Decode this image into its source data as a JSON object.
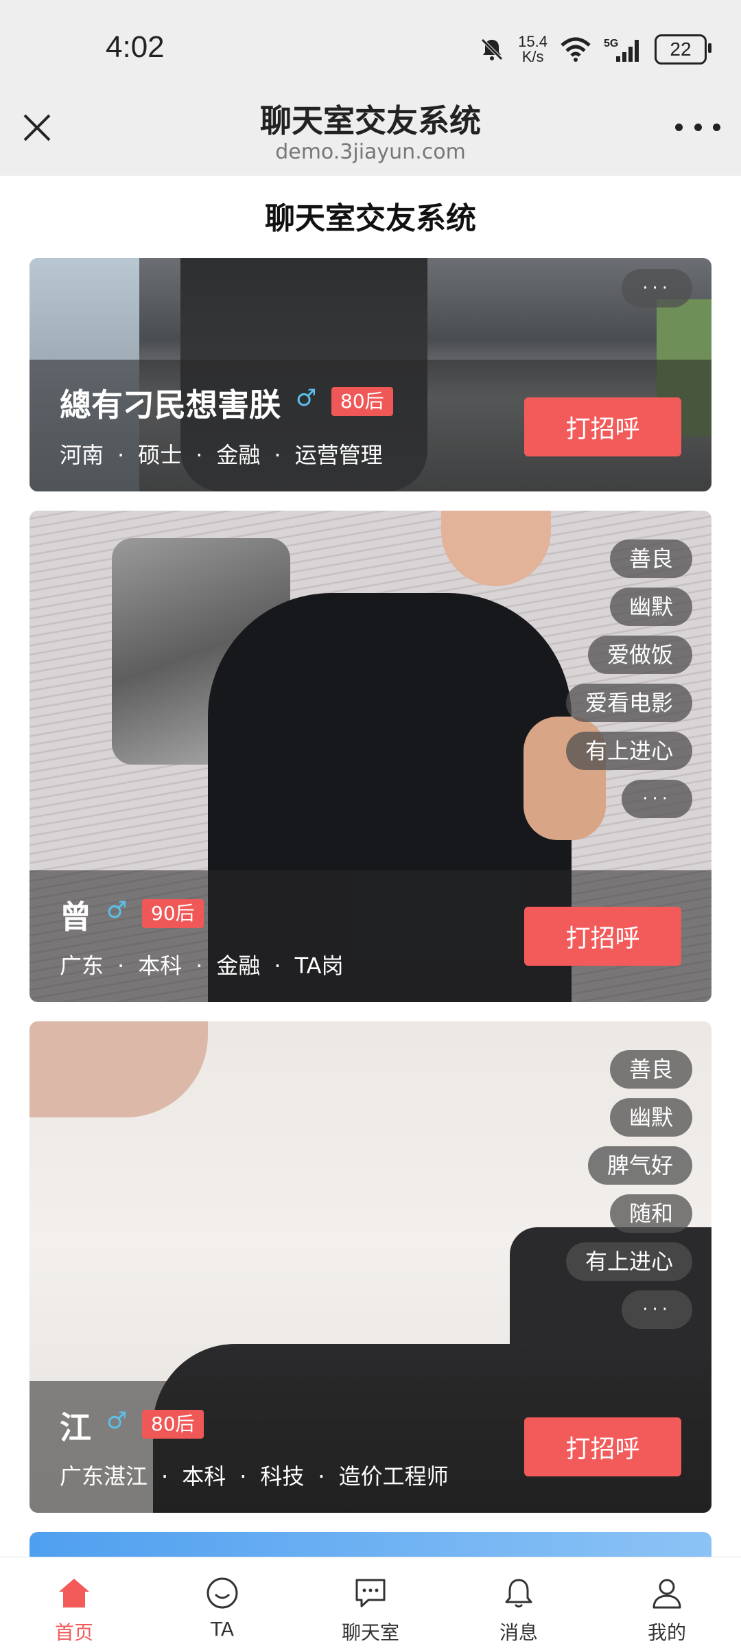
{
  "status_bar": {
    "time": "4:02",
    "net_speed_value": "15.4",
    "net_speed_unit": "K/s",
    "signal": "5G",
    "battery": "22"
  },
  "browser": {
    "title": "聊天室交友系统",
    "url": "demo.3jiayun.com"
  },
  "app": {
    "title": "聊天室交友系统"
  },
  "colors": {
    "accent": "#f35a5a",
    "age_badge": "#f05858",
    "male": "#5bc0eb"
  },
  "cards": [
    {
      "name": "總有刁民想害朕",
      "gender": "♂",
      "age": "80后",
      "location": "河南",
      "education": "硕士",
      "industry": "金融",
      "job": "运营管理",
      "tags": [],
      "more": "···",
      "greet": "打招呼"
    },
    {
      "name": "曾",
      "gender": "♂",
      "age": "90后",
      "location": "广东",
      "education": "本科",
      "industry": "金融",
      "job": "TA岗",
      "tags": [
        "善良",
        "幽默",
        "爱做饭",
        "爱看电影",
        "有上进心"
      ],
      "more": "···",
      "greet": "打招呼"
    },
    {
      "name": "江",
      "gender": "♂",
      "age": "80后",
      "location": "广东湛江",
      "education": "本科",
      "industry": "科技",
      "job": "造价工程师",
      "tags": [
        "善良",
        "幽默",
        "脾气好",
        "随和",
        "有上进心"
      ],
      "more": "···",
      "greet": "打招呼"
    }
  ],
  "nav": [
    {
      "label": "首页",
      "icon": "home-icon",
      "active": true
    },
    {
      "label": "TA",
      "icon": "smile-icon"
    },
    {
      "label": "聊天室",
      "icon": "chat-icon"
    },
    {
      "label": "消息",
      "icon": "bell-icon"
    },
    {
      "label": "我的",
      "icon": "user-icon"
    }
  ]
}
